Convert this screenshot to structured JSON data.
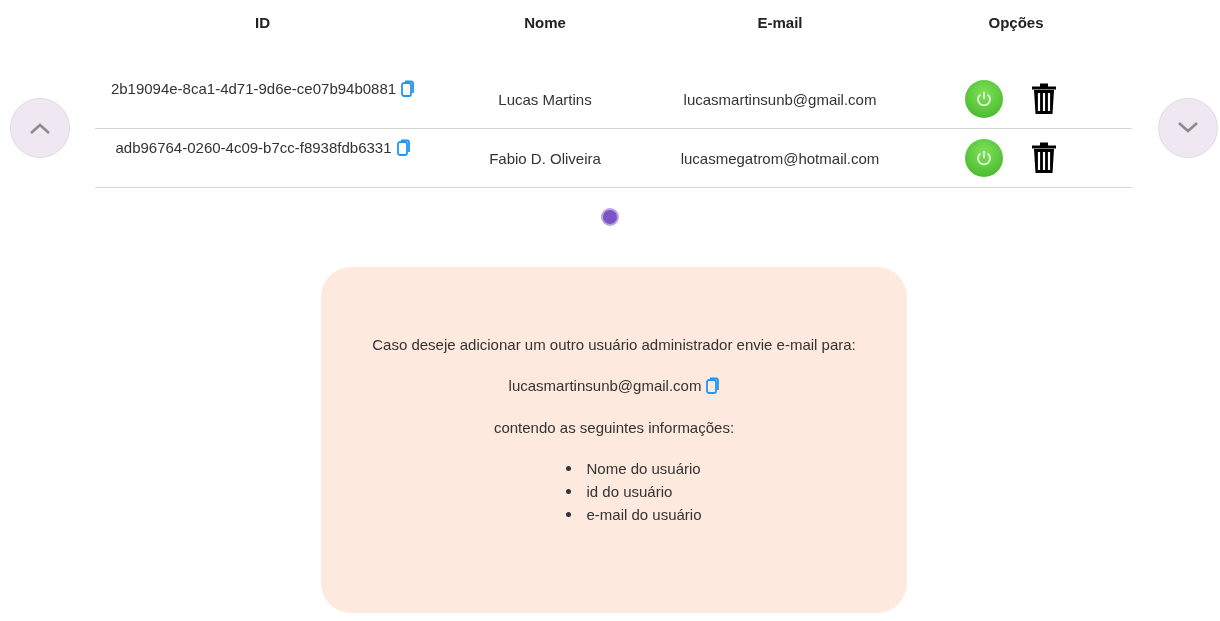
{
  "table": {
    "columns": [
      "ID",
      "Nome",
      "E-mail",
      "Opções"
    ],
    "rows": [
      {
        "id": "2b19094e-8ca1-4d71-9d6e-ce07b94b0881",
        "name": "Lucas Martins",
        "email": "lucasmartinsunb@gmail.com"
      },
      {
        "id": "adb96764-0260-4c09-b7cc-f8938fdb6331",
        "name": "Fabio D. Oliveira",
        "email": "lucasmegatrom@hotmail.com"
      }
    ]
  },
  "pages": [
    {
      "selected": true
    }
  ],
  "info_card": {
    "intro": "Caso deseje adicionar um outro usuário administrador envie e-mail para:",
    "email": "lucasmartinsunb@gmail.com",
    "lead": "contendo as seguintes informações:",
    "items": [
      "Nome do usuário",
      "id do usuário",
      "e-mail do usuário"
    ]
  }
}
